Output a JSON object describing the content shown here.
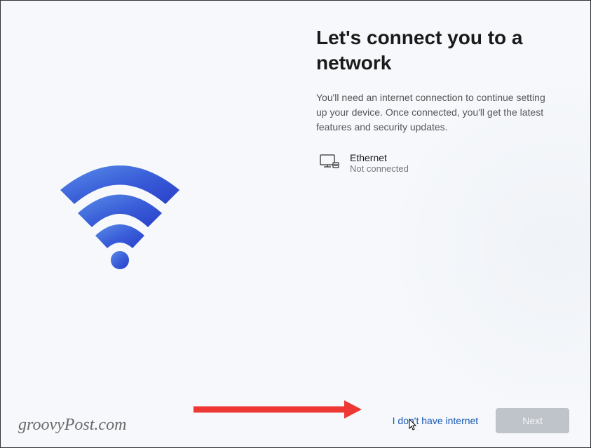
{
  "title": "Let's connect you to a network",
  "subtitle": "You'll need an internet connection to continue setting up your device. Once connected, you'll get the latest features and security updates.",
  "network": {
    "name": "Ethernet",
    "status": "Not connected"
  },
  "actions": {
    "skip_link": "I don't have internet",
    "next_button": "Next"
  },
  "watermark": "groovyPost.com"
}
